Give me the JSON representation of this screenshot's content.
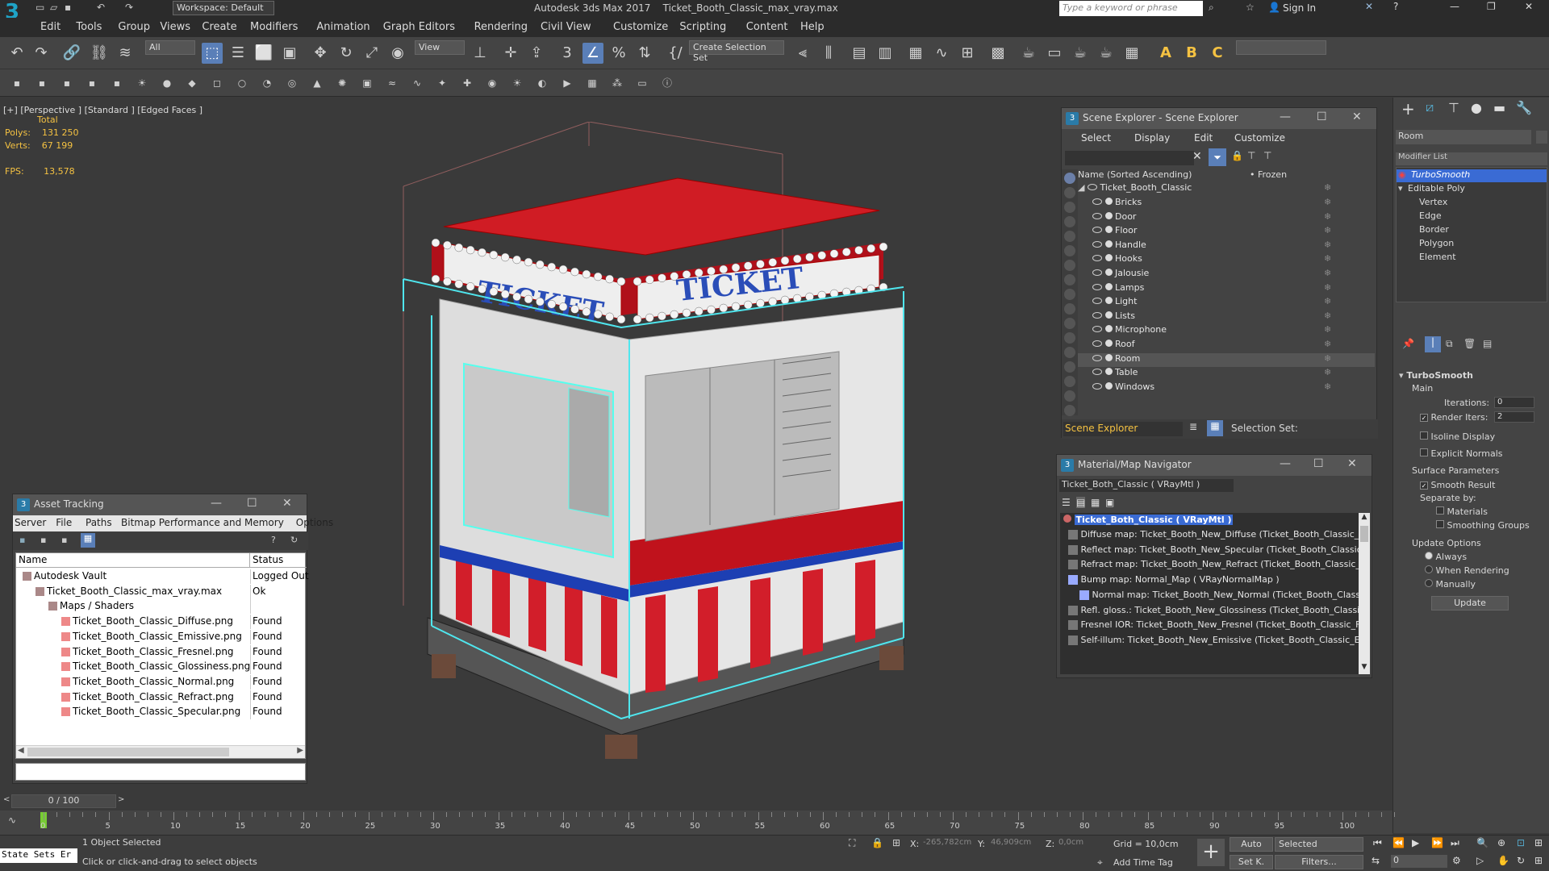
{
  "app": {
    "title": "Autodesk 3ds Max 2017",
    "file": "Ticket_Booth_Classic_max_vray.max",
    "workspace": "Workspace: Default",
    "search_placeholder": "Type a keyword or phrase",
    "sign_in": "Sign In"
  },
  "menu": [
    "Edit",
    "Tools",
    "Group",
    "Views",
    "Create",
    "Modifiers",
    "Animation",
    "Graph Editors",
    "Rendering",
    "Civil View",
    "Customize",
    "Scripting",
    "Content",
    "Help"
  ],
  "toolbar": {
    "filter": "All",
    "view": "View",
    "selection_set": "Create Selection Set",
    "icons": [
      "undo-icon",
      "redo-icon",
      "link-icon",
      "unlink-icon",
      "bind-spacewarp-icon",
      "select-object-icon",
      "select-by-name-icon",
      "rect-select-region-icon",
      "window-crossing-icon",
      "move-icon",
      "rotate-icon",
      "scale-icon",
      "place-icon",
      "snaps-3-icon",
      "angle-snap-icon",
      "percent-snap-icon",
      "spinner-snap-icon",
      "edit-named-sets-icon",
      "mirror-icon",
      "align-icon",
      "scene-explorer-icon",
      "layer-explorer-icon",
      "ribbon-icon",
      "curve-editor-icon",
      "schematic-icon",
      "material-editor-icon",
      "render-setup-icon",
      "rendered-frame-icon",
      "render-icon",
      "render-iterative-icon",
      "render-cloud-icon",
      "a-icon",
      "b-icon",
      "c-icon"
    ]
  },
  "viewport": {
    "label_plus": "[+]",
    "label_view": "[Perspective ]",
    "label_shading": "[Standard ]",
    "label_faces": "[Edged Faces ]",
    "stats_header": "Total",
    "polys_label": "Polys:",
    "polys": "131 250",
    "verts_label": "Verts:",
    "verts": "67 199",
    "fps_label": "FPS:",
    "fps": "13,578",
    "sign_left": "TICKET",
    "sign_right": "TICKET"
  },
  "scene_explorer": {
    "title": "Scene Explorer - Scene Explorer",
    "menu": [
      "Select",
      "Display",
      "Edit",
      "Customize"
    ],
    "col_name": "Name (Sorted Ascending)",
    "col_frozen": "• Frozen",
    "root": "Ticket_Booth_Classic",
    "items": [
      "Bricks",
      "Door",
      "Floor",
      "Handle",
      "Hooks",
      "Jalousie",
      "Lamps",
      "Light",
      "Lists",
      "Microphone",
      "Roof",
      "Room",
      "Table",
      "Windows"
    ],
    "selected": "Room",
    "footer_left": "Scene Explorer",
    "footer_right": "Selection Set:"
  },
  "material_nav": {
    "title": "Material/Map Navigator",
    "current": "Ticket_Both_Classic  ( VRayMtl )",
    "root": "Ticket_Both_Classic  ( VRayMtl )",
    "maps": [
      "Diffuse map: Ticket_Booth_New_Diffuse (Ticket_Booth_Classic_Diffuse",
      "Reflect map: Ticket_Booth_New_Specular (Ticket_Booth_Classic_Speci",
      "Refract map: Ticket_Booth_New_Refract (Ticket_Booth_Classic_Refrac",
      "Bump map: Normal_Map  ( VRayNormalMap )",
      "Normal map: Ticket_Booth_New_Normal (Ticket_Booth_Classic_Norm",
      "Refl. gloss.: Ticket_Booth_New_Glossiness (Ticket_Booth_Classic_Gloss",
      "Fresnel IOR: Ticket_Booth_New_Fresnel (Ticket_Booth_Classic_Fresnel",
      "Self-illum: Ticket_Booth_New_Emissive (Ticket_Booth_Classic_Emissive"
    ]
  },
  "asset_tracking": {
    "title": "Asset Tracking",
    "menu": [
      "Server",
      "File",
      "Paths",
      "Bitmap Performance and Memory",
      "Options"
    ],
    "col_name": "Name",
    "col_status": "Status",
    "rows": [
      {
        "name": "Autodesk Vault",
        "status": "Logged Out",
        "indent": 0
      },
      {
        "name": "Ticket_Booth_Classic_max_vray.max",
        "status": "Ok",
        "indent": 1
      },
      {
        "name": "Maps / Shaders",
        "status": "",
        "indent": 2
      },
      {
        "name": "Ticket_Booth_Classic_Diffuse.png",
        "status": "Found",
        "indent": 3
      },
      {
        "name": "Ticket_Booth_Classic_Emissive.png",
        "status": "Found",
        "indent": 3
      },
      {
        "name": "Ticket_Booth_Classic_Fresnel.png",
        "status": "Found",
        "indent": 3
      },
      {
        "name": "Ticket_Booth_Classic_Glossiness.png",
        "status": "Found",
        "indent": 3
      },
      {
        "name": "Ticket_Booth_Classic_Normal.png",
        "status": "Found",
        "indent": 3
      },
      {
        "name": "Ticket_Booth_Classic_Refract.png",
        "status": "Found",
        "indent": 3
      },
      {
        "name": "Ticket_Booth_Classic_Specular.png",
        "status": "Found",
        "indent": 3
      }
    ]
  },
  "command_panel": {
    "object_name": "Room",
    "modifier_list": "Modifier List",
    "stack": [
      "TurboSmooth",
      "Editable Poly",
      "Vertex",
      "Edge",
      "Border",
      "Polygon",
      "Element"
    ],
    "rollout": "TurboSmooth",
    "main": "Main",
    "iterations_label": "Iterations:",
    "iterations": "0",
    "render_iters_label": "Render Iters:",
    "render_iters": "2",
    "isoline": "Isoline Display",
    "explicit_normals": "Explicit Normals",
    "surface_params": "Surface Parameters",
    "smooth_result": "Smooth Result",
    "separate_by": "Separate by:",
    "materials": "Materials",
    "smoothing_groups": "Smoothing Groups",
    "update_options": "Update Options",
    "always": "Always",
    "when_rendering": "When Rendering",
    "manually": "Manually",
    "update_btn": "Update"
  },
  "timeline": {
    "frame": "0 / 100",
    "ticks": [
      "0",
      "5",
      "10",
      "15",
      "20",
      "25",
      "30",
      "35",
      "40",
      "45",
      "50",
      "55",
      "60",
      "65",
      "70",
      "75",
      "80",
      "85",
      "90",
      "95",
      "100"
    ]
  },
  "status": {
    "state_sets": "State Sets Er",
    "selected": "1 Object Selected",
    "prompt": "Click or click-and-drag to select objects",
    "x_label": "X:",
    "x": "-265,782cm",
    "y_label": "Y:",
    "y": "46,909cm",
    "z_label": "Z:",
    "z": "0,0cm",
    "grid": "Grid = 10,0cm",
    "add_time_tag": "Add Time Tag",
    "auto": "Auto",
    "set_k": "Set K.",
    "selected_dd": "Selected",
    "filters": "Filters...",
    "frame_field": "0"
  }
}
